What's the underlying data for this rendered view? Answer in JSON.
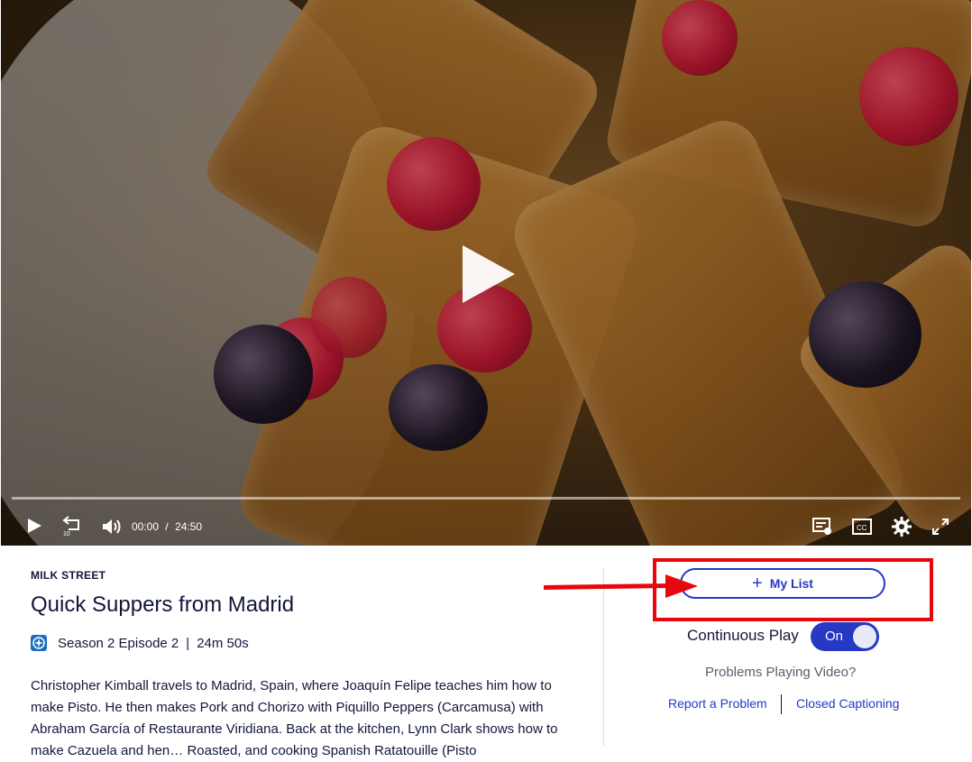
{
  "player": {
    "current_time": "00:00",
    "separator": "/",
    "duration": "24:50",
    "progress_fraction": 0.0
  },
  "episode": {
    "show": "MILK STREET",
    "title": "Quick Suppers from Madrid",
    "season_episode": "Season 2 Episode 2",
    "divider": "|",
    "runtime": "24m 50s",
    "description": "Christopher Kimball travels to Madrid, Spain, where Joaquín Felipe teaches him how to make Pisto. He then makes Pork and Chorizo with Piquillo Peppers (Carcamusa) with Abraham García of Restaurante Viridiana. Back at the kitchen, Lynn Clark shows how to make Cazuela and hen… Roasted, and cooking Spanish Ratatouille (Pisto"
  },
  "sidebar": {
    "my_list_icon": "+",
    "my_list_label": "My List",
    "continuous_play_label": "Continuous Play",
    "toggle_label": "On",
    "problems_label": "Problems Playing Video?",
    "report_link": "Report a Problem",
    "captioning_link": "Closed Captioning"
  },
  "colors": {
    "accent": "#2638c4",
    "annotation_red": "#e8070d",
    "text_dark": "#12173a"
  }
}
